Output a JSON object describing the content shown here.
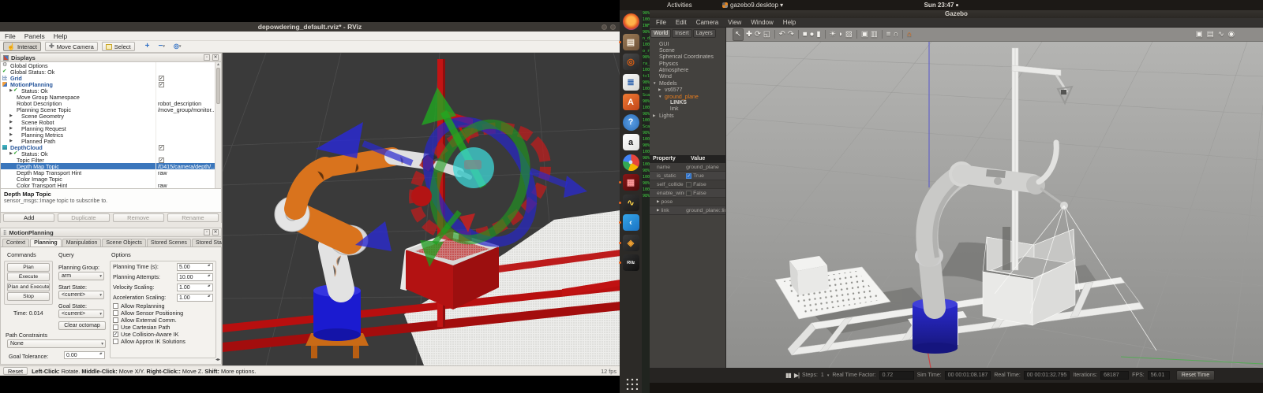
{
  "rviz": {
    "window_title": "depowdering_default.rviz* - RViz",
    "menus": [
      "File",
      "Panels",
      "Help"
    ],
    "toolbar": {
      "interact": "Interact",
      "move_camera": "Move Camera",
      "select": "Select"
    },
    "displays": {
      "header": "Displays",
      "rows": [
        {
          "icon": "gear",
          "label": "Global Options"
        },
        {
          "icon": "ok",
          "label": "Global Status: Ok"
        },
        {
          "icon": "grid",
          "label": "Grid",
          "blue": true,
          "chk": true
        },
        {
          "icon": "mp",
          "label": "MotionPlanning",
          "blue": true,
          "chk": true
        },
        {
          "exp": true,
          "icon": "ok",
          "label": "Status: Ok",
          "ind": 1
        },
        {
          "label": "Move Group Namespace",
          "ind": 1
        },
        {
          "label": "Robot Description",
          "value": "robot_description",
          "ind": 1
        },
        {
          "label": "Planning Scene Topic",
          "value": "/move_group/monitor...",
          "ind": 1
        },
        {
          "exp": true,
          "label": "Scene Geometry",
          "ind": 1
        },
        {
          "exp": true,
          "label": "Scene Robot",
          "ind": 1
        },
        {
          "exp": true,
          "label": "Planning Request",
          "ind": 1
        },
        {
          "exp": true,
          "label": "Planning Metrics",
          "ind": 1
        },
        {
          "exp": true,
          "label": "Planned Path",
          "ind": 1
        },
        {
          "icon": "dc",
          "label": "DepthCloud",
          "blue": true,
          "chk": true
        },
        {
          "exp": true,
          "icon": "ok",
          "label": "Status: Ok",
          "ind": 1
        },
        {
          "label": "Topic Filter",
          "ind": 1,
          "chk": true
        },
        {
          "label": "Depth Map Topic",
          "value": "/D415/camera/depth/...",
          "ind": 1,
          "sel": true
        },
        {
          "label": "Depth Map Transport Hint",
          "value": "raw",
          "ind": 1
        },
        {
          "label": "Color Image Topic",
          "ind": 1
        },
        {
          "label": "Color Transport Hint",
          "value": "raw",
          "ind": 1
        }
      ],
      "help_title": "Depth Map Topic",
      "help_body": "sensor_msgs::Image topic to subscribe to.",
      "buttons": [
        {
          "label": "Add",
          "enabled": true
        },
        {
          "label": "Duplicate"
        },
        {
          "label": "Remove"
        },
        {
          "label": "Rename"
        }
      ]
    },
    "motion_planning": {
      "header": "MotionPlanning",
      "tabs": [
        {
          "label": "Context"
        },
        {
          "label": "Planning",
          "active": true
        },
        {
          "label": "Manipulation"
        },
        {
          "label": "Scene Objects"
        },
        {
          "label": "Stored Scenes"
        },
        {
          "label": "Stored States"
        }
      ],
      "commands": {
        "title": "Commands",
        "buttons": [
          {
            "label": "Plan",
            "enabled": true
          },
          {
            "label": "Execute",
            "enabled": true
          },
          {
            "label": "Plan and Execute",
            "enabled": true
          },
          {
            "label": "Stop"
          }
        ],
        "time_label": "Time: 0.014"
      },
      "query": {
        "title": "Query",
        "planning_group_label": "Planning Group:",
        "planning_group": "arm",
        "start_state_label": "Start State:",
        "start_state": "<current>",
        "goal_state_label": "Goal State:",
        "goal_state": "<current>",
        "clear_octomap": "Clear octomap"
      },
      "options": {
        "title": "Options",
        "spins": [
          {
            "label": "Planning Time (s):",
            "value": "5.00"
          },
          {
            "label": "Planning Attempts:",
            "value": "10.00"
          },
          {
            "label": "Velocity Scaling:",
            "value": "1.00"
          },
          {
            "label": "Acceleration Scaling:",
            "value": "1.00"
          }
        ],
        "checks": [
          {
            "label": "Allow Replanning"
          },
          {
            "label": "Allow Sensor Positioning"
          },
          {
            "label": "Allow External Comm."
          },
          {
            "label": "Use Cartesian Path"
          },
          {
            "label": "Use Collision-Aware IK",
            "checked": true
          },
          {
            "label": "Allow Approx IK Solutions"
          }
        ]
      },
      "path_constraints": {
        "title": "Path Constraints",
        "value": "None",
        "goal_tolerance_label": "Goal Tolerance:",
        "goal_tolerance": "0.00"
      }
    },
    "status": {
      "reset": "Reset",
      "segments": [
        {
          "t": "Left-Click:",
          "b": true
        },
        {
          "t": " Rotate. "
        },
        {
          "t": "Middle-Click:",
          "b": true
        },
        {
          "t": " Move X/Y. "
        },
        {
          "t": "Right-Click::",
          "b": true
        },
        {
          "t": " Move Z. "
        },
        {
          "t": "Shift:",
          "b": true
        },
        {
          "t": " More options."
        }
      ],
      "fps": "12 fps"
    }
  },
  "desktop": {
    "activities": "Activities",
    "indicator": "gazebo9.desktop ▾",
    "clock": "Sun 23:47",
    "dock": [
      {
        "name": "dock-firefox-icon",
        "glyph": "",
        "fg": "#ffb24a",
        "bg": "radial-gradient(circle at 50% 45%, #ffb24a 0 34%, #e2571e 58%, #8d2ea0 82%, #3d2a84)",
        "round": true
      },
      {
        "name": "dock-files-icon",
        "glyph": "▤",
        "fg": "#f0e6d6",
        "bg": "linear-gradient(145deg,#9a7a55,#6e5238)",
        "dot": true
      },
      {
        "name": "dock-rhythmbox-icon",
        "glyph": "◎",
        "fg": "#e06010",
        "bg": "linear-gradient(145deg,#4a4a4a,#262626)"
      },
      {
        "name": "dock-writer-icon",
        "glyph": "≣",
        "fg": "#3468b0",
        "bg": "linear-gradient(145deg,#f8f8f6,#d8d8d4)"
      },
      {
        "name": "dock-ubuntu-software-icon",
        "glyph": "A",
        "fg": "#ffffff",
        "bg": "linear-gradient(145deg,#ef7b33,#c2451a)"
      },
      {
        "name": "dock-help-icon",
        "glyph": "?",
        "fg": "#ffffff",
        "bg": "radial-gradient(circle,#5aa0e8,#2c6cb4)",
        "round": true
      },
      {
        "name": "dock-amazon-icon",
        "glyph": "a",
        "fg": "#1a1a1a",
        "bg": "linear-gradient(145deg,#ffffff,#e4e4e2)"
      },
      {
        "name": "dock-chrome-icon",
        "glyph": "●",
        "fg": "#cfe3f8",
        "bg": "conic-gradient(#e8453c 0 120deg,#f4b400 120deg 200deg,#34a853 200deg 280deg,#4285f4 280deg 360deg)",
        "round": true
      },
      {
        "name": "dock-red-tool-icon",
        "glyph": "▦",
        "fg": "#ff9a9a",
        "bg": "linear-gradient(145deg,#8a1616,#4e0b0b)",
        "dot": true
      },
      {
        "name": "dock-signal-scope-icon",
        "glyph": "∿",
        "fg": "#ffd44a",
        "bg": "linear-gradient(145deg,#343434,#1a1a1a)",
        "dot": true
      },
      {
        "name": "dock-vscode-icon",
        "glyph": "‹",
        "fg": "#ffffff",
        "bg": "linear-gradient(145deg,#35a5e8,#1a73c4)",
        "dot": true
      },
      {
        "name": "dock-gazebo-icon",
        "glyph": "◈",
        "fg": "#f0a030",
        "bg": "linear-gradient(145deg,#3c3c3c,#1e1e1e)",
        "dot": true
      },
      {
        "name": "dock-rviz-icon",
        "glyph": "RViz",
        "fg": "#f0f0f0",
        "bg": "linear-gradient(145deg,#2e2e2e,#101010)",
        "dot": true,
        "tiny": true
      }
    ],
    "terminal_lines": [
      "98%",
      "100%",
      "INF",
      "98%",
      "n_de",
      "100%",
      "o_ro",
      "98%",
      "ra_a",
      "100%",
      "tclo",
      "98%",
      "100%",
      "Scan",
      "98%",
      "100%",
      "98%",
      "100%",
      "Scan",
      "98%",
      "100%",
      "98%",
      "100%",
      "98%",
      "100%",
      "98%",
      "100%",
      "98%",
      "100%",
      "98%"
    ]
  },
  "gazebo": {
    "window_title": "Gazebo",
    "menus": [
      "File",
      "Edit",
      "Camera",
      "View",
      "Window",
      "Help"
    ],
    "panel": {
      "tabs": [
        {
          "label": "World",
          "active": true
        },
        {
          "label": "Insert"
        },
        {
          "label": "Layers"
        }
      ],
      "tree": [
        {
          "label": "GUI"
        },
        {
          "label": "Scene"
        },
        {
          "label": "Spherical Coordinates"
        },
        {
          "label": "Physics"
        },
        {
          "label": "Atmosphere"
        },
        {
          "label": "Wind"
        },
        {
          "label": "Models",
          "exp": "▼"
        },
        {
          "label": "vs6577",
          "exp": "▶",
          "ind": 1
        },
        {
          "label": "ground_plane",
          "exp": "▼",
          "ind": 1,
          "selo": true
        },
        {
          "label": "LINKS",
          "ind": 2,
          "bold": true
        },
        {
          "label": "link",
          "ind": 2
        },
        {
          "label": "Lights",
          "exp": "▶"
        }
      ],
      "prop_header_left": "Property",
      "prop_header_right": "Value",
      "props": [
        {
          "name": "name",
          "value": "ground_plane"
        },
        {
          "name": "is_static",
          "value": "True",
          "chk": true,
          "checked": true
        },
        {
          "name": "self_collide",
          "value": "False",
          "chk": true
        },
        {
          "name": "enable_wind",
          "value": "False",
          "chk": true
        },
        {
          "name": "pose",
          "exp": true
        },
        {
          "name": "link",
          "value": "ground_plane::lin",
          "exp": true
        }
      ]
    },
    "toolbar_left": [
      {
        "name": "select-tool-icon",
        "g": "↖",
        "sel": true
      },
      {
        "name": "translate-tool-icon",
        "g": "✚"
      },
      {
        "name": "rotate-tool-icon",
        "g": "⟳"
      },
      {
        "name": "scale-tool-icon",
        "g": "◱"
      },
      {
        "name": "toolbar-separator",
        "sep": true
      },
      {
        "name": "undo-icon",
        "g": "↶"
      },
      {
        "name": "redo-icon",
        "g": "↷"
      },
      {
        "name": "toolbar-separator",
        "sep": true
      },
      {
        "name": "insert-box-icon",
        "g": "■"
      },
      {
        "name": "insert-sphere-icon",
        "g": "●"
      },
      {
        "name": "insert-cylinder-icon",
        "g": "▮"
      },
      {
        "name": "toolbar-separator",
        "sep": true
      },
      {
        "name": "point-light-icon",
        "g": "☀"
      },
      {
        "name": "spot-light-icon",
        "g": "◗"
      },
      {
        "name": "directional-light-icon",
        "g": "▨"
      },
      {
        "name": "toolbar-separator",
        "sep": true
      },
      {
        "name": "copy-icon",
        "g": "▣"
      },
      {
        "name": "paste-icon",
        "g": "▥"
      },
      {
        "name": "toolbar-separator",
        "sep": true
      },
      {
        "name": "align-icon",
        "g": "≡"
      },
      {
        "name": "snap-icon",
        "g": "∩"
      },
      {
        "name": "toolbar-separator",
        "sep": true
      },
      {
        "name": "building-editor-icon",
        "g": "⌂",
        "orange": true
      }
    ],
    "toolbar_right": [
      {
        "name": "screenshot-icon",
        "g": "▣"
      },
      {
        "name": "data-logger-icon",
        "g": "▤"
      },
      {
        "name": "plot-icon",
        "g": "∿"
      },
      {
        "name": "video-record-icon",
        "g": "◉"
      }
    ],
    "status": {
      "steps_label": "Steps:",
      "steps": "1",
      "rtf_label": "Real Time Factor:",
      "rtf": "0.72",
      "sim_label": "Sim Time:",
      "sim": "00 00:01:08.187",
      "real_label": "Real Time:",
      "real": "00 00:01:32.795",
      "iter_label": "Iterations:",
      "iterations": "68187",
      "fps_label": "FPS:",
      "fps": "56.01",
      "reset": "Reset Time"
    }
  }
}
